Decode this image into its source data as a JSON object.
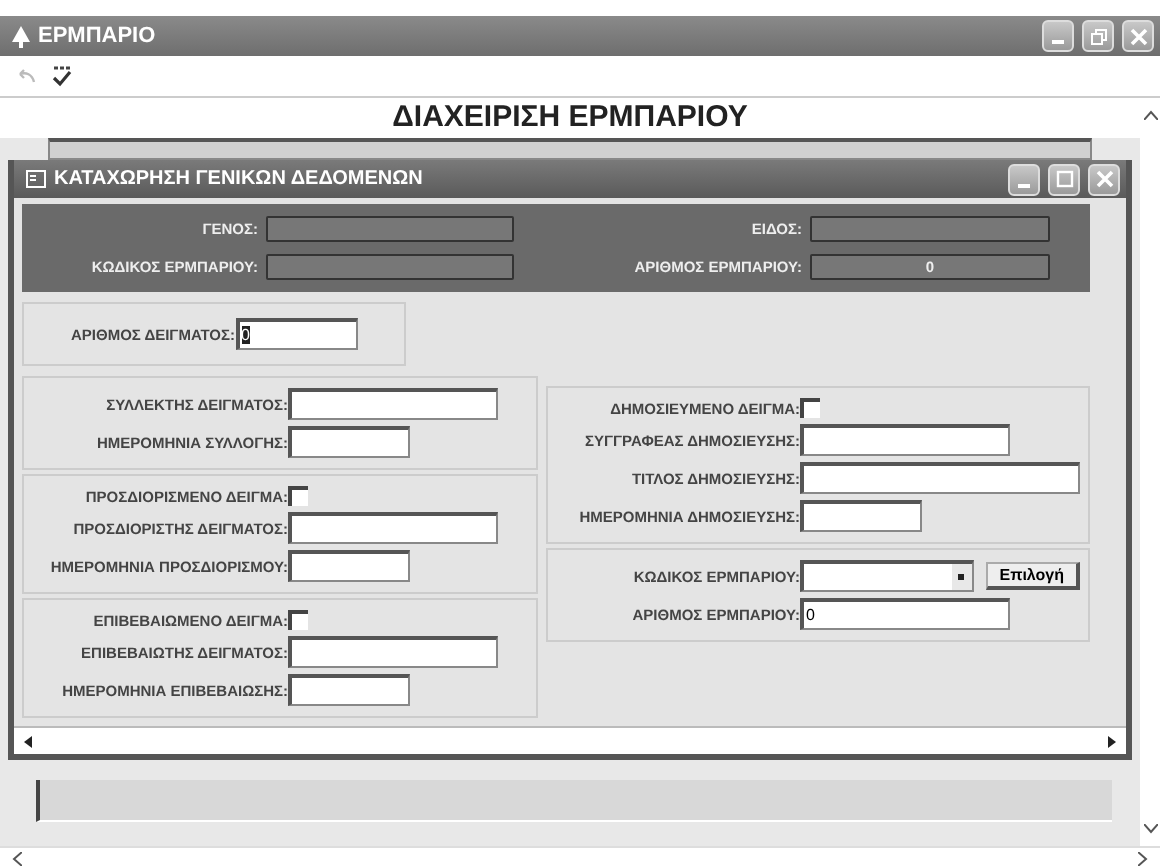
{
  "window": {
    "title": "ΕΡΜΠΑΡΙΟ"
  },
  "heading": "ΔΙΑΧΕΙΡΙΣΗ ΕΡΜΠΑΡΙΟΥ",
  "dialog": {
    "title": "ΚΑΤΑΧΩΡΗΣΗ ΓΕΝΙΚΩΝ ΔΕΔΟΜΕΝΩΝ",
    "header_fields": [
      {
        "label": "ΓΕΝΟΣ:"
      },
      {
        "label": "ΕΙΔΟΣ:"
      },
      {
        "label": "ΚΩΔΙΚΟΣ ΕΡΜΠΑΡΙΟΥ:"
      },
      {
        "label": "ΑΡΙΘΜΟΣ ΕΡΜΠΑΡΙΟΥ:",
        "value": "0"
      }
    ],
    "sample_number": {
      "label": "ΑΡΙΘΜΟΣ ΔΕΙΓΜΑΤΟΣ:",
      "value": "0",
      "text_selected": true
    },
    "left_groups": [
      {
        "fields": [
          {
            "kind": "text",
            "label": "ΣΥΛΛΕΚΤΗΣ ΔΕΙΓΜΑΤΟΣ:"
          },
          {
            "kind": "date",
            "label": "ΗΜΕΡΟΜΗΝΙΑ ΣΥΛΛΟΓΗΣ:"
          }
        ]
      },
      {
        "fields": [
          {
            "kind": "checkbox",
            "label": "ΠΡΟΣΔΙΟΡΙΣΜΕΝΟ ΔΕΙΓΜΑ:",
            "checked": false
          },
          {
            "kind": "text",
            "label": "ΠΡΟΣΔΙΟΡΙΣΤΗΣ ΔΕΙΓΜΑΤΟΣ:"
          },
          {
            "kind": "date",
            "label": "ΗΜΕΡΟΜΗΝΙΑ ΠΡΟΣΔΙΟΡΙΣΜΟΥ:"
          }
        ]
      },
      {
        "fields": [
          {
            "kind": "checkbox",
            "label": "ΕΠΙΒΕΒΑΙΩΜΕΝΟ ΔΕΙΓΜΑ:",
            "checked": false
          },
          {
            "kind": "text",
            "label": "ΕΠΙΒΕΒΑΙΩΤΗΣ ΔΕΙΓΜΑΤΟΣ:"
          },
          {
            "kind": "date",
            "label": "ΗΜΕΡΟΜΗΝΙΑ ΕΠΙΒΕΒΑΙΩΣΗΣ:"
          }
        ]
      }
    ],
    "right_groups": [
      {
        "fields": [
          {
            "kind": "checkbox",
            "label": "ΔΗΜΟΣΙΕΥΜΕΝΟ ΔΕΙΓΜΑ:",
            "checked": false
          },
          {
            "kind": "text",
            "label": "ΣΥΓΓΡΑΦΕΑΣ ΔΗΜΟΣΙΕΥΣΗΣ:"
          },
          {
            "kind": "wide",
            "label": "ΤΙΤΛΟΣ ΔΗΜΟΣΙΕΥΣΗΣ:"
          },
          {
            "kind": "date",
            "label": "ΗΜΕΡΟΜΗΝΙΑ ΔΗΜΟΣΙΕΥΣΗΣ:"
          }
        ]
      },
      {
        "fields": [
          {
            "kind": "combo",
            "label": "ΚΩΔΙΚΟΣ ΕΡΜΠΑΡΙΟΥ:",
            "button": "Επιλογή"
          },
          {
            "kind": "text",
            "label": "ΑΡΙΘΜΟΣ ΕΡΜΠΑΡΙΟΥ:",
            "value": "0"
          }
        ]
      }
    ]
  }
}
